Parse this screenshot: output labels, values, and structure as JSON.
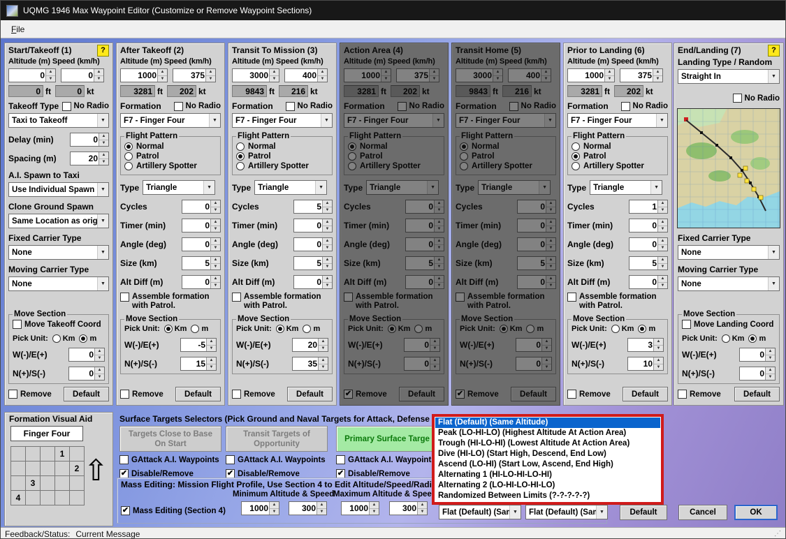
{
  "window": {
    "title": "UQMG 1946 Max Waypoint Editor (Customize or Remove Waypoint Sections)",
    "menu": [
      {
        "label": "File"
      }
    ]
  },
  "ui": {
    "alt_speed_header": "Altitude (m) Speed (km/h)",
    "ft": "ft",
    "kt": "kt",
    "formation_label": "Formation",
    "no_radio": "No Radio",
    "flight_pattern": "Flight Pattern",
    "normal": "Normal",
    "patrol": "Patrol",
    "artillery": "Artillery Spotter",
    "type_label": "Type",
    "cycles": "Cycles",
    "timer": "Timer (min)",
    "angle": "Angle (deg)",
    "size": "Size (km)",
    "alt_diff": "Alt Diff (m)",
    "assemble": "Assemble formation with Patrol.",
    "move_section": "Move Section",
    "pick_unit": "Pick Unit:",
    "km": "Km",
    "m": "m",
    "we": "W(-)/E(+)",
    "ns": "N(+)/S(-)",
    "remove": "Remove",
    "default_btn": "Default",
    "icons": {
      "chevron_down": "▼",
      "spin_up": "▲",
      "spin_down": "▼",
      "check": "✔",
      "formation_arrow": "⇧",
      "help": "?",
      "grip": "⋰"
    }
  },
  "columns": [
    {
      "type": "start",
      "title": "Start/Takeoff (1)",
      "help_badge": "?",
      "altitude": "0",
      "speed": "0",
      "alt_ft": "0",
      "speed_kt": "0",
      "takeoff_type_label": "Takeoff Type",
      "no_radio_checked": false,
      "takeoff_type": "Taxi to Takeoff",
      "delay_label": "Delay (min)",
      "delay": "0",
      "spacing_label": "Spacing (m)",
      "spacing": "20",
      "spawn_label": "A.I. Spawn to Taxi",
      "spawn": "Use Individual Spawn",
      "clone_label": "Clone Ground Spawn",
      "clone": "Same Location as orig",
      "fixed_label": "Fixed Carrier Type",
      "fixed": "None",
      "moving_label": "Moving Carrier Type",
      "moving": "None",
      "move_coord_label": "Move Takeoff Coord",
      "move_coord_checked": false,
      "unit": "m",
      "we": "0",
      "ns": "0",
      "remove_checked": false,
      "dark": false
    },
    {
      "type": "standard",
      "title": "After Takeoff (2)",
      "altitude": "1000",
      "speed": "375",
      "alt_ft": "3281",
      "speed_kt": "202",
      "no_radio_checked": false,
      "formation": "F7 - Finger Four",
      "pattern": "Normal",
      "ptype": "Triangle",
      "cycles": "0",
      "timer": "0",
      "angle": "0",
      "size": "5",
      "alt_diff": "0",
      "assemble_checked": false,
      "unit": "Km",
      "we": "-5",
      "ns": "15",
      "remove_checked": false,
      "dark": false
    },
    {
      "type": "standard",
      "title": "Transit To Mission (3)",
      "altitude": "3000",
      "speed": "400",
      "alt_ft": "9843",
      "speed_kt": "216",
      "no_radio_checked": false,
      "formation": "F7 - Finger Four",
      "pattern": "Patrol",
      "ptype": "Triangle",
      "cycles": "5",
      "timer": "0",
      "angle": "0",
      "size": "5",
      "alt_diff": "0",
      "assemble_checked": false,
      "unit": "Km",
      "we": "20",
      "ns": "35",
      "remove_checked": false,
      "dark": false
    },
    {
      "type": "standard",
      "title": "Action Area (4)",
      "altitude": "1000",
      "speed": "375",
      "alt_ft": "3281",
      "speed_kt": "202",
      "no_radio_checked": false,
      "formation": "F7 - Finger Four",
      "pattern": "Normal",
      "ptype": "Triangle",
      "cycles": "0",
      "timer": "0",
      "angle": "0",
      "size": "5",
      "alt_diff": "0",
      "assemble_checked": false,
      "unit": "Km",
      "we": "0",
      "ns": "0",
      "remove_checked": true,
      "dark": true
    },
    {
      "type": "standard",
      "title": "Transit Home (5)",
      "altitude": "3000",
      "speed": "400",
      "alt_ft": "9843",
      "speed_kt": "216",
      "no_radio_checked": false,
      "formation": "F7 - Finger Four",
      "pattern": "Normal",
      "ptype": "Triangle",
      "cycles": "0",
      "timer": "0",
      "angle": "0",
      "size": "5",
      "alt_diff": "0",
      "assemble_checked": false,
      "unit": "Km",
      "we": "0",
      "ns": "0",
      "remove_checked": true,
      "dark": true
    },
    {
      "type": "standard",
      "title": "Prior to Landing (6)",
      "altitude": "1000",
      "speed": "375",
      "alt_ft": "3281",
      "speed_kt": "202",
      "no_radio_checked": false,
      "formation": "F7 - Finger Four",
      "pattern": "Patrol",
      "ptype": "Triangle",
      "cycles": "1",
      "timer": "0",
      "angle": "0",
      "size": "5",
      "alt_diff": "0",
      "assemble_checked": false,
      "unit": "m",
      "we": "3",
      "ns": "10",
      "remove_checked": false,
      "dark": false
    },
    {
      "type": "end",
      "title": "End/Landing (7)",
      "help_badge": "?",
      "landing_label": "Landing Type / Random",
      "landing": "Straight In",
      "no_radio_checked": false,
      "fixed_label": "Fixed Carrier Type",
      "fixed": "None",
      "moving_label": "Moving Carrier Type",
      "moving": "None",
      "move_coord_label": "Move Landing Coord",
      "move_coord_checked": false,
      "unit": "m",
      "we": "0",
      "ns": "0",
      "remove_checked": false,
      "dark": false
    }
  ],
  "bottom": {
    "formation_aid": {
      "title": "Formation Visual Aid",
      "name": "Finger Four",
      "positions": [
        {
          "n": "1",
          "col": 3,
          "row": 0
        },
        {
          "n": "2",
          "col": 4,
          "row": 1
        },
        {
          "n": "3",
          "col": 1,
          "row": 2
        },
        {
          "n": "4",
          "col": 0,
          "row": 3
        }
      ]
    },
    "surface": {
      "label": "Surface Targets Selectors (Pick Ground and Naval Targets for Attack, Defense or Re",
      "buttons": [
        {
          "line1": "Targets Close to Base",
          "line2": "On Start",
          "style": "disabled"
        },
        {
          "line1": "Transit Targets of",
          "line2": "Opportunity",
          "style": "disabled"
        },
        {
          "line1": "Primary Surface Targe",
          "line2": "",
          "style": "green"
        }
      ],
      "groups": [
        {
          "gattack": "GAttack A.I. Waypoints",
          "gattack_checked": false,
          "disable": "Disable/Remove",
          "disable_checked": true
        },
        {
          "gattack": "GAttack A.I. Waypoints",
          "gattack_checked": false,
          "disable": "Disable/Remove",
          "disable_checked": true
        },
        {
          "gattack": "GAttack A.I. Waypoints",
          "gattack_checked": false,
          "disable": "Disable/Remove",
          "disable_checked": true
        }
      ]
    },
    "mass": {
      "line1": "Mass Editing:  Mission Flight Profile, Use Section 4 to Edit Altitude/Speed/Radio/",
      "min_header": "Minimum Altitude & Speed",
      "max_header": "Maximum Altitude & Spee",
      "checkbox_label": "Mass Editing (Section 4)",
      "checkbox_checked": true,
      "values": [
        "1000",
        "300",
        "1000",
        "300"
      ],
      "combo1": "Flat (Default) (Sam",
      "combo2": "Flat (Default) (Sam"
    },
    "popup": {
      "annotation_color": "#d01b1b",
      "highlight_color": "#0a64cd",
      "items": [
        {
          "label": "Flat (Default) (Same Altitude)",
          "selected": true
        },
        {
          "label": "Peak (LO-HI-LO) (Highest Altitude At Action Area)",
          "selected": false
        },
        {
          "label": "Trough (HI-LO-HI) (Lowest Altitude At Action Area)",
          "selected": false
        },
        {
          "label": "Dive (HI-LO) (Start High, Descend, End Low)",
          "selected": false
        },
        {
          "label": "Ascend (LO-HI) (Start Low, Ascend, End High)",
          "selected": false
        },
        {
          "label": "Alternating 1 (HI-LO-HI-LO-HI)",
          "selected": false
        },
        {
          "label": "Alternating 2 (LO-HI-LO-HI-LO)",
          "selected": false
        },
        {
          "label": "Randomized Between Limits (?-?-?-?-?)",
          "selected": false
        }
      ]
    },
    "actions": {
      "default": "Default",
      "cancel": "Cancel",
      "ok": "OK"
    }
  },
  "status": {
    "label": "Feedback/Status:",
    "value": "Current Message"
  }
}
